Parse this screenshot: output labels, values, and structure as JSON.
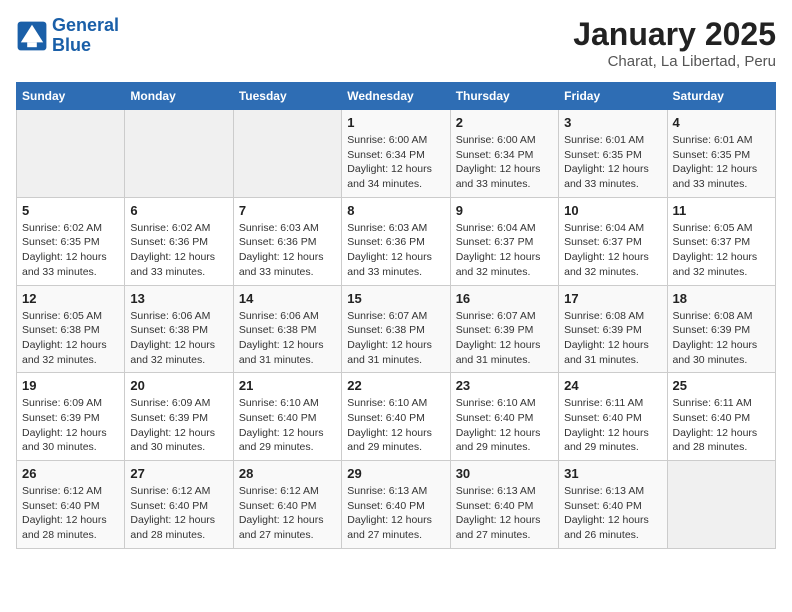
{
  "app": {
    "logo_text_general": "General",
    "logo_text_blue": "Blue",
    "title": "January 2025",
    "subtitle": "Charat, La Libertad, Peru"
  },
  "calendar": {
    "headers": [
      "Sunday",
      "Monday",
      "Tuesday",
      "Wednesday",
      "Thursday",
      "Friday",
      "Saturday"
    ],
    "weeks": [
      [
        {
          "day": "",
          "info": ""
        },
        {
          "day": "",
          "info": ""
        },
        {
          "day": "",
          "info": ""
        },
        {
          "day": "1",
          "info": "Sunrise: 6:00 AM\nSunset: 6:34 PM\nDaylight: 12 hours\nand 34 minutes."
        },
        {
          "day": "2",
          "info": "Sunrise: 6:00 AM\nSunset: 6:34 PM\nDaylight: 12 hours\nand 33 minutes."
        },
        {
          "day": "3",
          "info": "Sunrise: 6:01 AM\nSunset: 6:35 PM\nDaylight: 12 hours\nand 33 minutes."
        },
        {
          "day": "4",
          "info": "Sunrise: 6:01 AM\nSunset: 6:35 PM\nDaylight: 12 hours\nand 33 minutes."
        }
      ],
      [
        {
          "day": "5",
          "info": "Sunrise: 6:02 AM\nSunset: 6:35 PM\nDaylight: 12 hours\nand 33 minutes."
        },
        {
          "day": "6",
          "info": "Sunrise: 6:02 AM\nSunset: 6:36 PM\nDaylight: 12 hours\nand 33 minutes."
        },
        {
          "day": "7",
          "info": "Sunrise: 6:03 AM\nSunset: 6:36 PM\nDaylight: 12 hours\nand 33 minutes."
        },
        {
          "day": "8",
          "info": "Sunrise: 6:03 AM\nSunset: 6:36 PM\nDaylight: 12 hours\nand 33 minutes."
        },
        {
          "day": "9",
          "info": "Sunrise: 6:04 AM\nSunset: 6:37 PM\nDaylight: 12 hours\nand 32 minutes."
        },
        {
          "day": "10",
          "info": "Sunrise: 6:04 AM\nSunset: 6:37 PM\nDaylight: 12 hours\nand 32 minutes."
        },
        {
          "day": "11",
          "info": "Sunrise: 6:05 AM\nSunset: 6:37 PM\nDaylight: 12 hours\nand 32 minutes."
        }
      ],
      [
        {
          "day": "12",
          "info": "Sunrise: 6:05 AM\nSunset: 6:38 PM\nDaylight: 12 hours\nand 32 minutes."
        },
        {
          "day": "13",
          "info": "Sunrise: 6:06 AM\nSunset: 6:38 PM\nDaylight: 12 hours\nand 32 minutes."
        },
        {
          "day": "14",
          "info": "Sunrise: 6:06 AM\nSunset: 6:38 PM\nDaylight: 12 hours\nand 31 minutes."
        },
        {
          "day": "15",
          "info": "Sunrise: 6:07 AM\nSunset: 6:38 PM\nDaylight: 12 hours\nand 31 minutes."
        },
        {
          "day": "16",
          "info": "Sunrise: 6:07 AM\nSunset: 6:39 PM\nDaylight: 12 hours\nand 31 minutes."
        },
        {
          "day": "17",
          "info": "Sunrise: 6:08 AM\nSunset: 6:39 PM\nDaylight: 12 hours\nand 31 minutes."
        },
        {
          "day": "18",
          "info": "Sunrise: 6:08 AM\nSunset: 6:39 PM\nDaylight: 12 hours\nand 30 minutes."
        }
      ],
      [
        {
          "day": "19",
          "info": "Sunrise: 6:09 AM\nSunset: 6:39 PM\nDaylight: 12 hours\nand 30 minutes."
        },
        {
          "day": "20",
          "info": "Sunrise: 6:09 AM\nSunset: 6:39 PM\nDaylight: 12 hours\nand 30 minutes."
        },
        {
          "day": "21",
          "info": "Sunrise: 6:10 AM\nSunset: 6:40 PM\nDaylight: 12 hours\nand 29 minutes."
        },
        {
          "day": "22",
          "info": "Sunrise: 6:10 AM\nSunset: 6:40 PM\nDaylight: 12 hours\nand 29 minutes."
        },
        {
          "day": "23",
          "info": "Sunrise: 6:10 AM\nSunset: 6:40 PM\nDaylight: 12 hours\nand 29 minutes."
        },
        {
          "day": "24",
          "info": "Sunrise: 6:11 AM\nSunset: 6:40 PM\nDaylight: 12 hours\nand 29 minutes."
        },
        {
          "day": "25",
          "info": "Sunrise: 6:11 AM\nSunset: 6:40 PM\nDaylight: 12 hours\nand 28 minutes."
        }
      ],
      [
        {
          "day": "26",
          "info": "Sunrise: 6:12 AM\nSunset: 6:40 PM\nDaylight: 12 hours\nand 28 minutes."
        },
        {
          "day": "27",
          "info": "Sunrise: 6:12 AM\nSunset: 6:40 PM\nDaylight: 12 hours\nand 28 minutes."
        },
        {
          "day": "28",
          "info": "Sunrise: 6:12 AM\nSunset: 6:40 PM\nDaylight: 12 hours\nand 27 minutes."
        },
        {
          "day": "29",
          "info": "Sunrise: 6:13 AM\nSunset: 6:40 PM\nDaylight: 12 hours\nand 27 minutes."
        },
        {
          "day": "30",
          "info": "Sunrise: 6:13 AM\nSunset: 6:40 PM\nDaylight: 12 hours\nand 27 minutes."
        },
        {
          "day": "31",
          "info": "Sunrise: 6:13 AM\nSunset: 6:40 PM\nDaylight: 12 hours\nand 26 minutes."
        },
        {
          "day": "",
          "info": ""
        }
      ]
    ]
  }
}
